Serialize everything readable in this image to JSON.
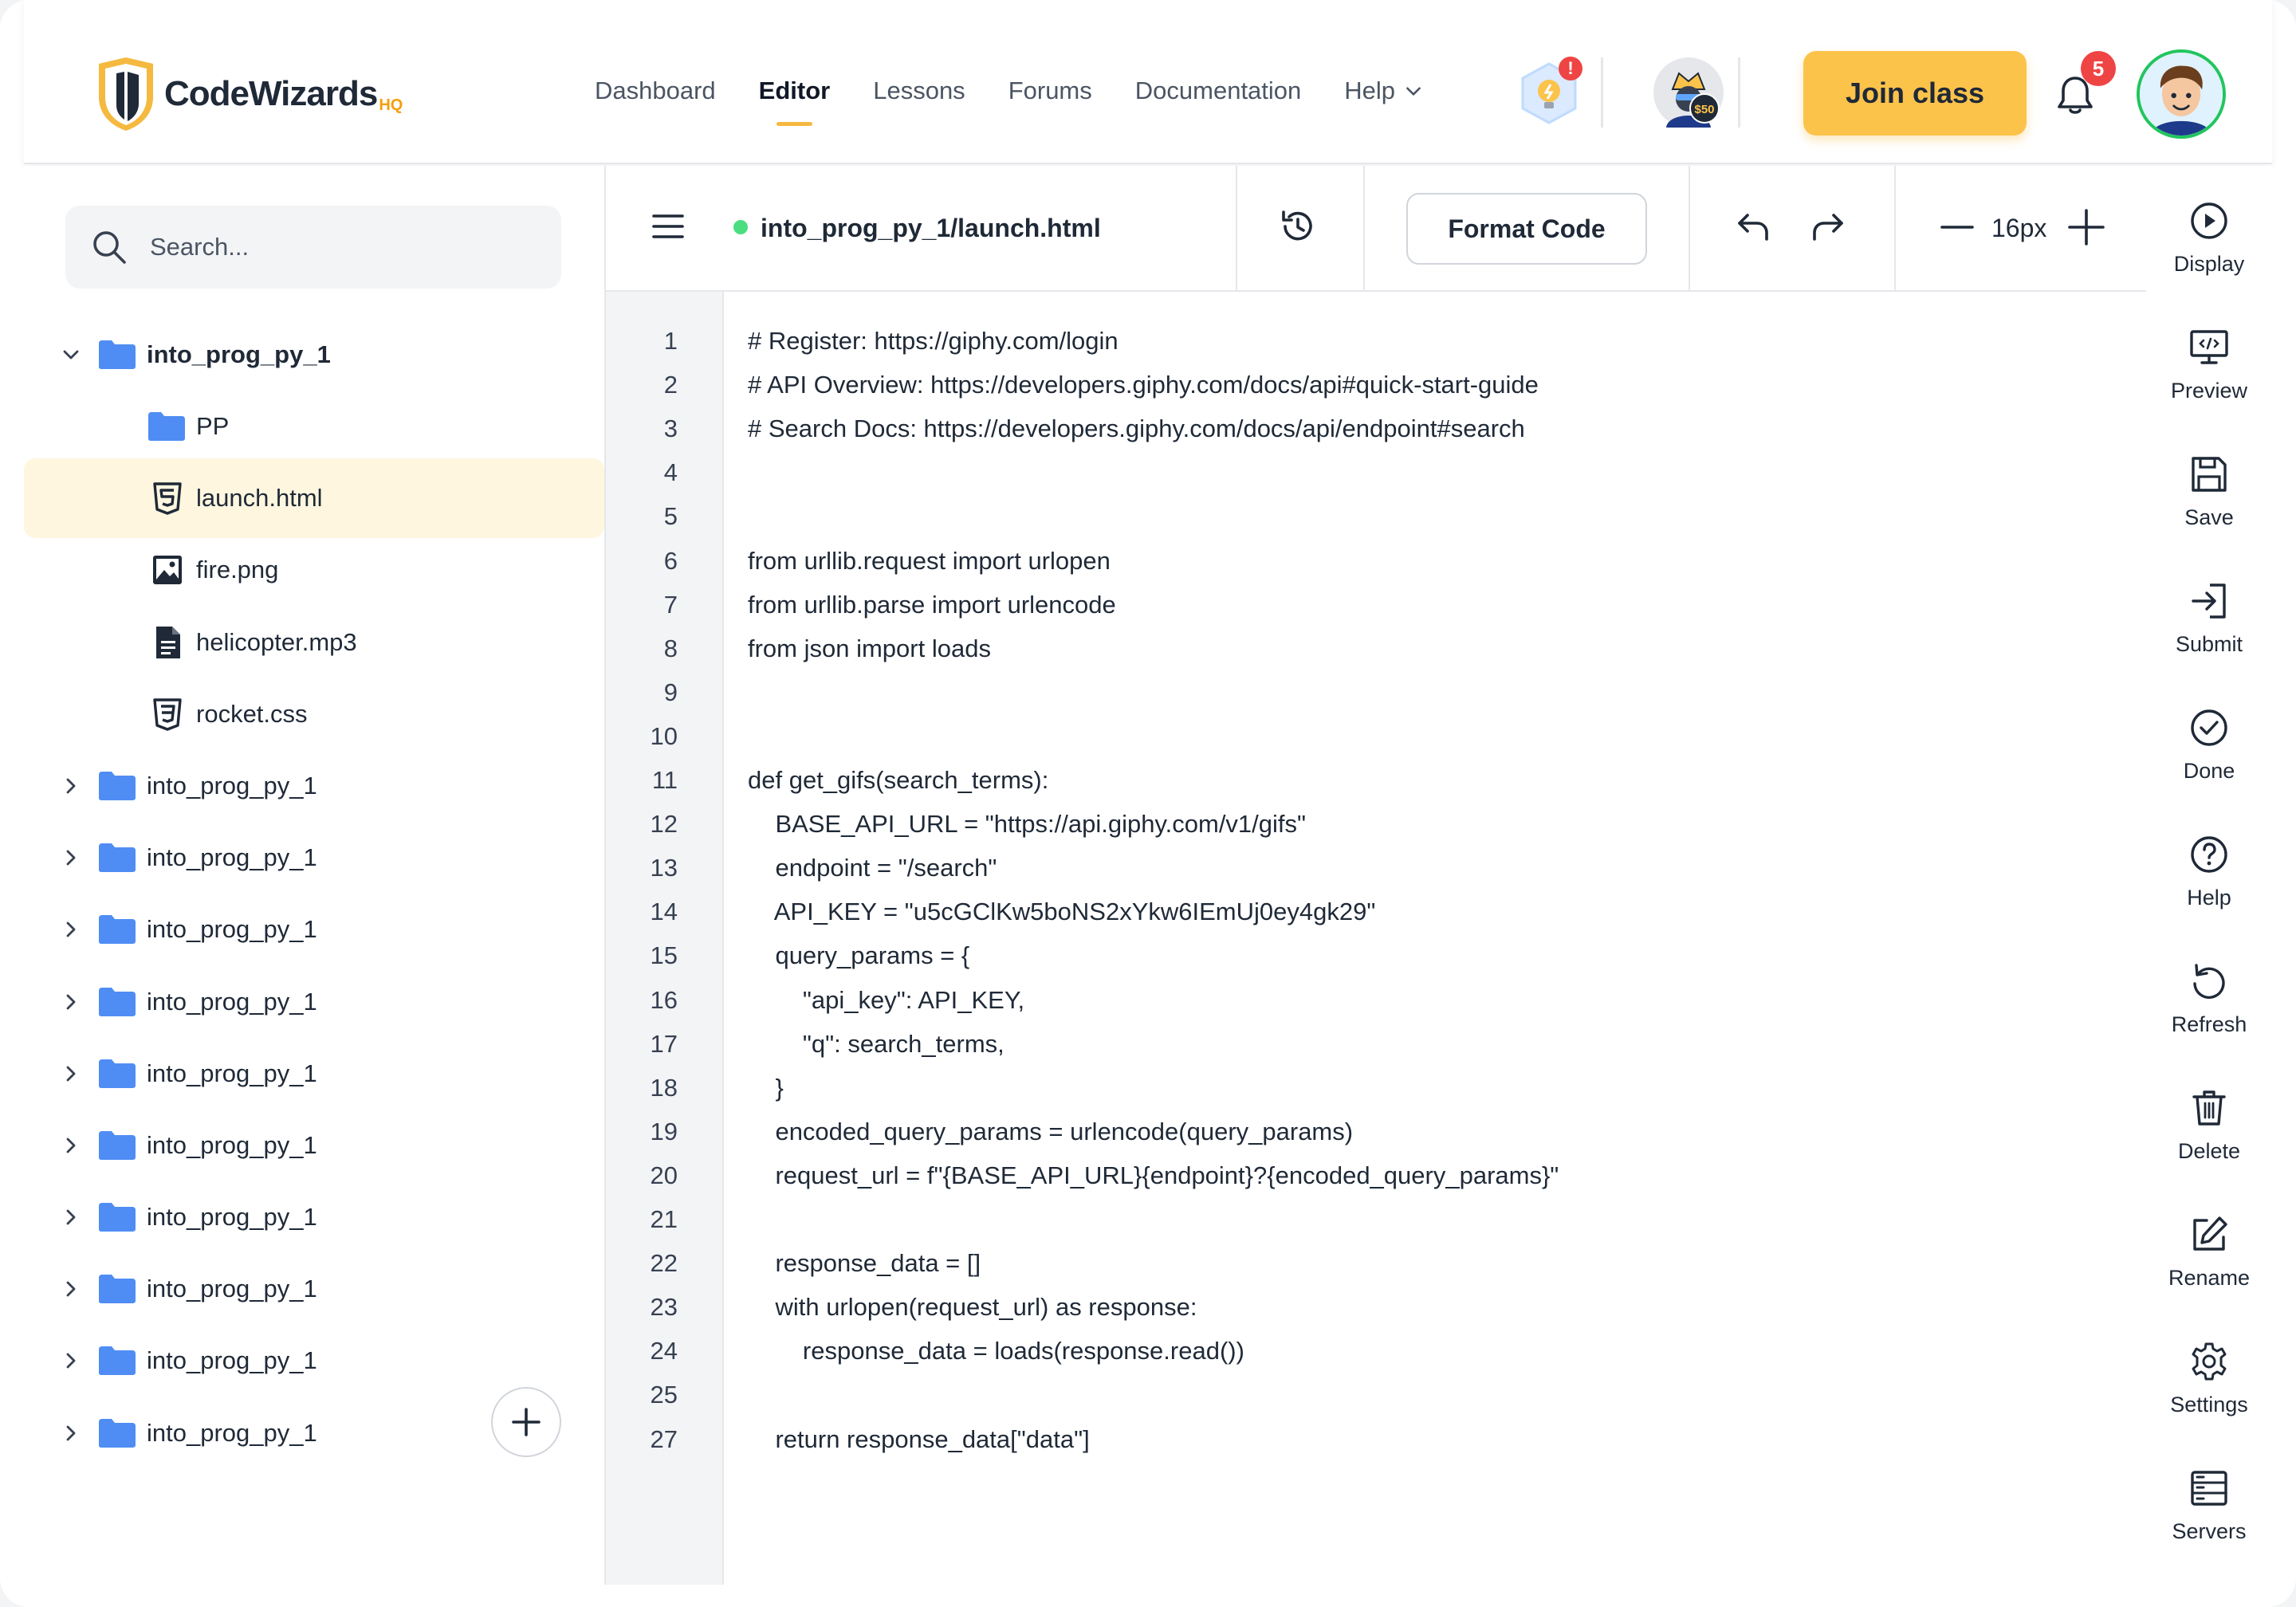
{
  "brand": {
    "name": "CodeWizards",
    "suffix": "HQ"
  },
  "nav": {
    "items": [
      "Dashboard",
      "Editor",
      "Lessons",
      "Forums",
      "Documentation"
    ],
    "help_label": "Help",
    "active": "Editor"
  },
  "header": {
    "coin_badge": "$50",
    "join_label": "Join class",
    "notification_count": "5",
    "hint_alert": "!"
  },
  "search": {
    "placeholder": "Search..."
  },
  "tree": {
    "root": {
      "label": "into_prog_py_1",
      "expanded": true
    },
    "children": [
      {
        "label": "PP",
        "kind": "folder"
      },
      {
        "label": "launch.html",
        "kind": "html",
        "selected": true
      },
      {
        "label": "fire.png",
        "kind": "image"
      },
      {
        "label": "helicopter.mp3",
        "kind": "document"
      },
      {
        "label": "rocket.css",
        "kind": "css"
      }
    ],
    "collapsed_folders": [
      "into_prog_py_1",
      "into_prog_py_1",
      "into_prog_py_1",
      "into_prog_py_1",
      "into_prog_py_1",
      "into_prog_py_1",
      "into_prog_py_1",
      "into_prog_py_1",
      "into_prog_py_1",
      "into_prog_py_1"
    ]
  },
  "editor": {
    "file_path": "into_prog_py_1/launch.html",
    "format_label": "Format Code",
    "font_size": "16px",
    "status_color": "#4ade80",
    "line_numbers": [
      "1",
      "2",
      "3",
      "4",
      "5",
      "6",
      "7",
      "8",
      "9",
      "10",
      "11",
      "12",
      "13",
      "14",
      "15",
      "16",
      "17",
      "18",
      "19",
      "20",
      "21",
      "22",
      "23",
      "24",
      "25",
      "27"
    ],
    "code_lines": [
      "# Register: https://giphy.com/login",
      "# API Overview: https://developers.giphy.com/docs/api#quick-start-guide",
      "# Search Docs: https://developers.giphy.com/docs/api/endpoint#search",
      "",
      "",
      "from urllib.request import urlopen",
      "from urllib.parse import urlencode",
      "from json import loads",
      "",
      "",
      "def get_gifs(search_terms):",
      "    BASE_API_URL = \"https://api.giphy.com/v1/gifs\"",
      "    endpoint = \"/search\"",
      "    API_KEY = \"u5cGClKw5boNS2xYkw6IEmUj0ey4gk29\"",
      "    query_params = {",
      "        \"api_key\": API_KEY,",
      "        \"q\": search_terms,",
      "    }",
      "    encoded_query_params = urlencode(query_params)",
      "    request_url = f\"{BASE_API_URL}{endpoint}?{encoded_query_params}\"",
      "",
      "    response_data = []",
      "    with urlopen(request_url) as response:",
      "        response_data = loads(response.read())",
      "",
      "    return response_data[\"data\"]"
    ]
  },
  "rail": {
    "items": [
      {
        "label": "Display",
        "icon": "play-circle-icon"
      },
      {
        "label": "Preview",
        "icon": "monitor-code-icon"
      },
      {
        "label": "Save",
        "icon": "floppy-icon"
      },
      {
        "label": "Submit",
        "icon": "sign-in-icon"
      },
      {
        "label": "Done",
        "icon": "check-circle-icon"
      },
      {
        "label": "Help",
        "icon": "question-circle-icon"
      },
      {
        "label": "Refresh",
        "icon": "refresh-icon"
      },
      {
        "label": "Delete",
        "icon": "trash-icon"
      },
      {
        "label": "Rename",
        "icon": "edit-icon"
      },
      {
        "label": "Settings",
        "icon": "gear-icon"
      },
      {
        "label": "Servers",
        "icon": "server-icon"
      }
    ]
  },
  "colors": {
    "accent": "#fcc34b",
    "folder": "#4f8df5",
    "selected_row": "#fff6df",
    "alert": "#ef4444",
    "avatar_ring": "#22c55e"
  }
}
